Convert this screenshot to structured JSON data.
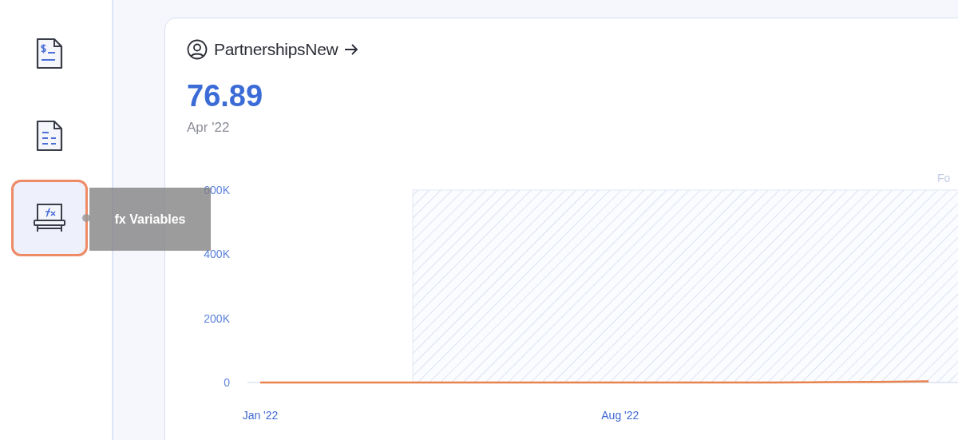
{
  "sidebar": {
    "items": [
      {
        "kind": "invoice",
        "selected": false
      },
      {
        "kind": "report",
        "selected": false
      },
      {
        "kind": "variables",
        "selected": true
      }
    ],
    "tooltip": "fx Variables"
  },
  "card": {
    "title": "PartnershipsNew",
    "value": "76.89",
    "date": "Apr '22",
    "chart_data": {
      "type": "line",
      "categories": [
        "Jan '22",
        null,
        null,
        null,
        null,
        null,
        null,
        "Aug '22",
        null,
        null,
        null,
        null,
        null,
        null
      ],
      "series": [
        {
          "color": "#e8834e",
          "values": [
            0,
            0,
            0,
            0,
            0,
            0,
            0,
            0,
            0,
            0,
            0,
            1000,
            2000,
            4000
          ]
        }
      ],
      "ylim": [
        0,
        600000
      ],
      "yticks": [
        {
          "value": 0,
          "label": "0"
        },
        {
          "value": 200000,
          "label": "200K"
        },
        {
          "value": 400000,
          "label": "400K"
        },
        {
          "value": 600000,
          "label": "600K"
        }
      ],
      "annotations": [
        "Fo"
      ]
    }
  }
}
